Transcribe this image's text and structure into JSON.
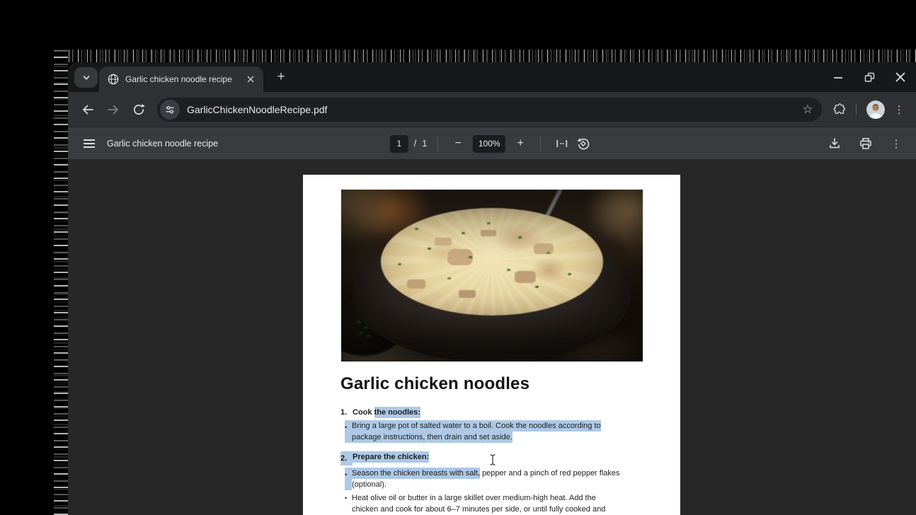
{
  "colors": {
    "selection_highlight": "#adc9e5",
    "chrome_bg": "#303134",
    "tabstrip_bg": "#17181a",
    "omnibox_bg": "#1e1f22",
    "pdf_toolbar_bg": "#3a3b3e",
    "viewer_bg": "#272728",
    "page_bg": "#ffffff"
  },
  "icons": {
    "kebab": "⋮",
    "star": "☆",
    "plus": "+",
    "minus": "−",
    "tab_search": "chevron-down",
    "favicon": "globe",
    "tab_close": "x-cross",
    "window_minimize": "minimize-line",
    "window_restore": "overlapping-squares",
    "window_close": "x-cross",
    "back": "arrow-left",
    "forward": "arrow-right",
    "reload": "circular-arrow",
    "site_settings": "tune-sliders",
    "extensions": "puzzle-piece",
    "pdf_menu": "hamburger",
    "fit_width": "fit-to-width",
    "rotate": "rotate-counterclockwise",
    "download": "download-arrow",
    "print": "printer",
    "text_cursor": "i-beam"
  },
  "browser": {
    "tab_title": "Garlic chicken noodle recipe",
    "url": "GarlicChickenNoodleRecipe.pdf"
  },
  "pdf_toolbar": {
    "title": "Garlic chicken noodle recipe",
    "page_current": "1",
    "page_separator": "/",
    "page_total": "1",
    "zoom_level": "100%"
  },
  "document": {
    "heading": "Garlic chicken noodles",
    "items": [
      {
        "kind": "numbered",
        "marker": "1.",
        "bold": true,
        "marker_hl": false,
        "segments": [
          {
            "t": "Cook ",
            "hl": false
          },
          {
            "t": "the noodles:",
            "hl": true
          }
        ]
      },
      {
        "kind": "bullet",
        "marker": "•",
        "bold": false,
        "marker_hl": true,
        "segments": [
          {
            "t": "Bring a large pot of salted water to a boil. Cook the noodles according to",
            "hl": true
          },
          {
            "br": true
          },
          {
            "t": "package instructions, then drain and set aside.",
            "hl": true
          }
        ]
      },
      {
        "kind": "numbered",
        "marker": "2.",
        "bold": true,
        "marker_hl": true,
        "segments": [
          {
            "t": "Prepare the chicken:",
            "hl": true
          }
        ]
      },
      {
        "kind": "bullet",
        "marker": "•",
        "bold": false,
        "marker_hl": true,
        "segments": [
          {
            "t": "Season the chicken breasts with salt,",
            "hl": true
          },
          {
            "t": " pepper and a pinch of red pepper flakes",
            "hl": false
          },
          {
            "br": true
          },
          {
            "t": "(optional).",
            "hl": false
          }
        ]
      },
      {
        "kind": "bullet",
        "marker": "•",
        "bold": false,
        "marker_hl": false,
        "segments": [
          {
            "t": "Heat olive oil or butter in a large skillet over medium-high heat. Add the",
            "hl": false
          },
          {
            "br": true
          },
          {
            "t": "chicken and cook for about 6–7 minutes per side, or until fully cooked and",
            "hl": false
          }
        ]
      }
    ]
  }
}
